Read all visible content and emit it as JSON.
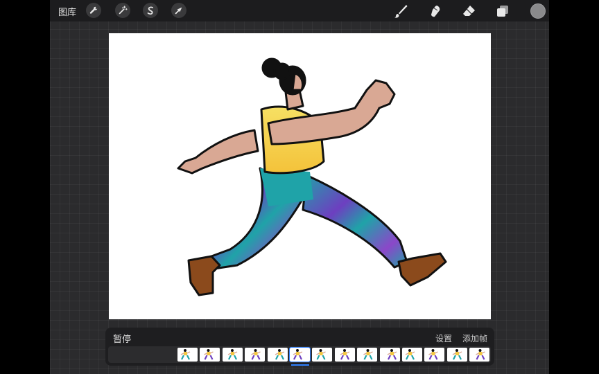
{
  "topbar": {
    "gallery_label": "图库",
    "left_tools": [
      {
        "icon": "wrench-icon",
        "name": "actions"
      },
      {
        "icon": "magic-wand-icon",
        "name": "adjustments"
      },
      {
        "icon": "selection-s-icon",
        "name": "selection"
      },
      {
        "icon": "arrow-cursor-icon",
        "name": "transform"
      }
    ],
    "right_tools": [
      {
        "icon": "brush-icon",
        "name": "paint"
      },
      {
        "icon": "smudge-icon",
        "name": "smudge"
      },
      {
        "icon": "eraser-icon",
        "name": "erase"
      },
      {
        "icon": "layers-icon",
        "name": "layers"
      }
    ],
    "current_color": "#8a8a8c"
  },
  "timeline": {
    "pause_label": "暂停",
    "settings_label": "设置",
    "add_frame_label": "添加帧",
    "frame_count": 14,
    "current_frame_index": 5,
    "accent_color": "#2f80ff"
  },
  "colors": {
    "background": "#2b2b2d",
    "topbar": "#1c1c1e",
    "shirt": "#f4c842",
    "pants_teal": "#1fa3a8",
    "pants_purple": "#6d3fc0",
    "skin": "#d9a894",
    "shoes": "#8b4a1c",
    "hair": "#111111"
  }
}
